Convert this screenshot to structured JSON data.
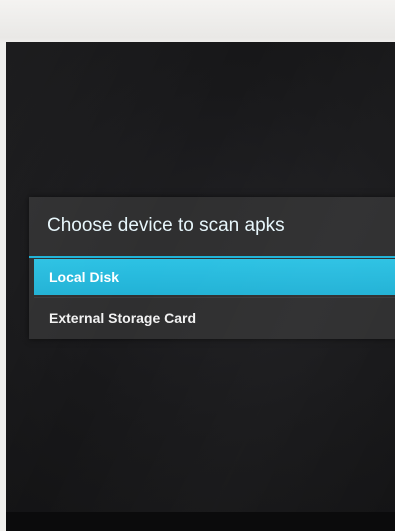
{
  "dialog": {
    "title": "Choose device to scan apks",
    "options": [
      {
        "label": "Local Disk",
        "selected": true
      },
      {
        "label": "External Storage Card",
        "selected": false
      }
    ]
  },
  "colors": {
    "accent": "#22b2d6",
    "dialog_background": "#2f2f30",
    "screen_background": "#18181a"
  }
}
